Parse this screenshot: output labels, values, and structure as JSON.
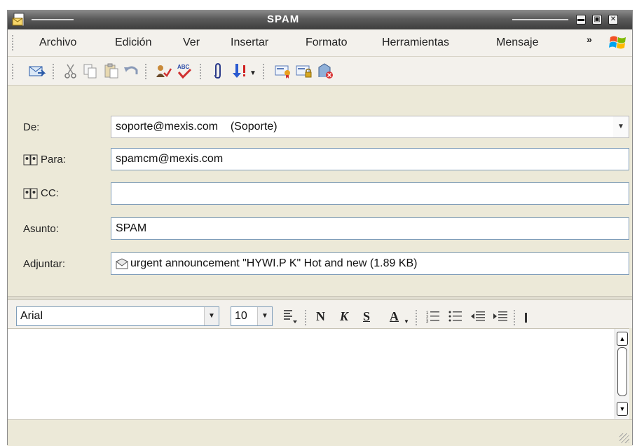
{
  "window": {
    "title": "SPAM"
  },
  "menu": {
    "items": [
      "Archivo",
      "Edición",
      "Ver",
      "Insertar",
      "Formato",
      "Herramientas",
      "Mensaje"
    ],
    "overflow": "»"
  },
  "toolbar": {
    "icons": [
      "send-icon",
      "cut-icon",
      "copy-icon",
      "paste-icon",
      "undo-icon",
      "check-names-icon",
      "spelling-icon",
      "attach-icon",
      "priority-icon",
      "sign-icon",
      "encrypt-icon",
      "offline-icon"
    ]
  },
  "header": {
    "from_label": "De:",
    "from_value": "soporte@mexis.com    (Soporte)",
    "to_label": "Para:",
    "to_value": "spamcm@mexis.com",
    "cc_label": "CC:",
    "cc_value": "",
    "subject_label": "Asunto:",
    "subject_value": "SPAM",
    "attach_label": "Adjuntar:",
    "attach_value": "urgent announcement \"HYWI.P K\" Hot and new (1.89 KB)"
  },
  "format": {
    "font": "Arial",
    "size": "10",
    "bold": "N",
    "italic": "K",
    "underline": "S",
    "color": "A"
  },
  "colors": {
    "titlebar": "#4a4a4a",
    "chrome": "#ece9d8",
    "field_border": "#7f9db9"
  }
}
